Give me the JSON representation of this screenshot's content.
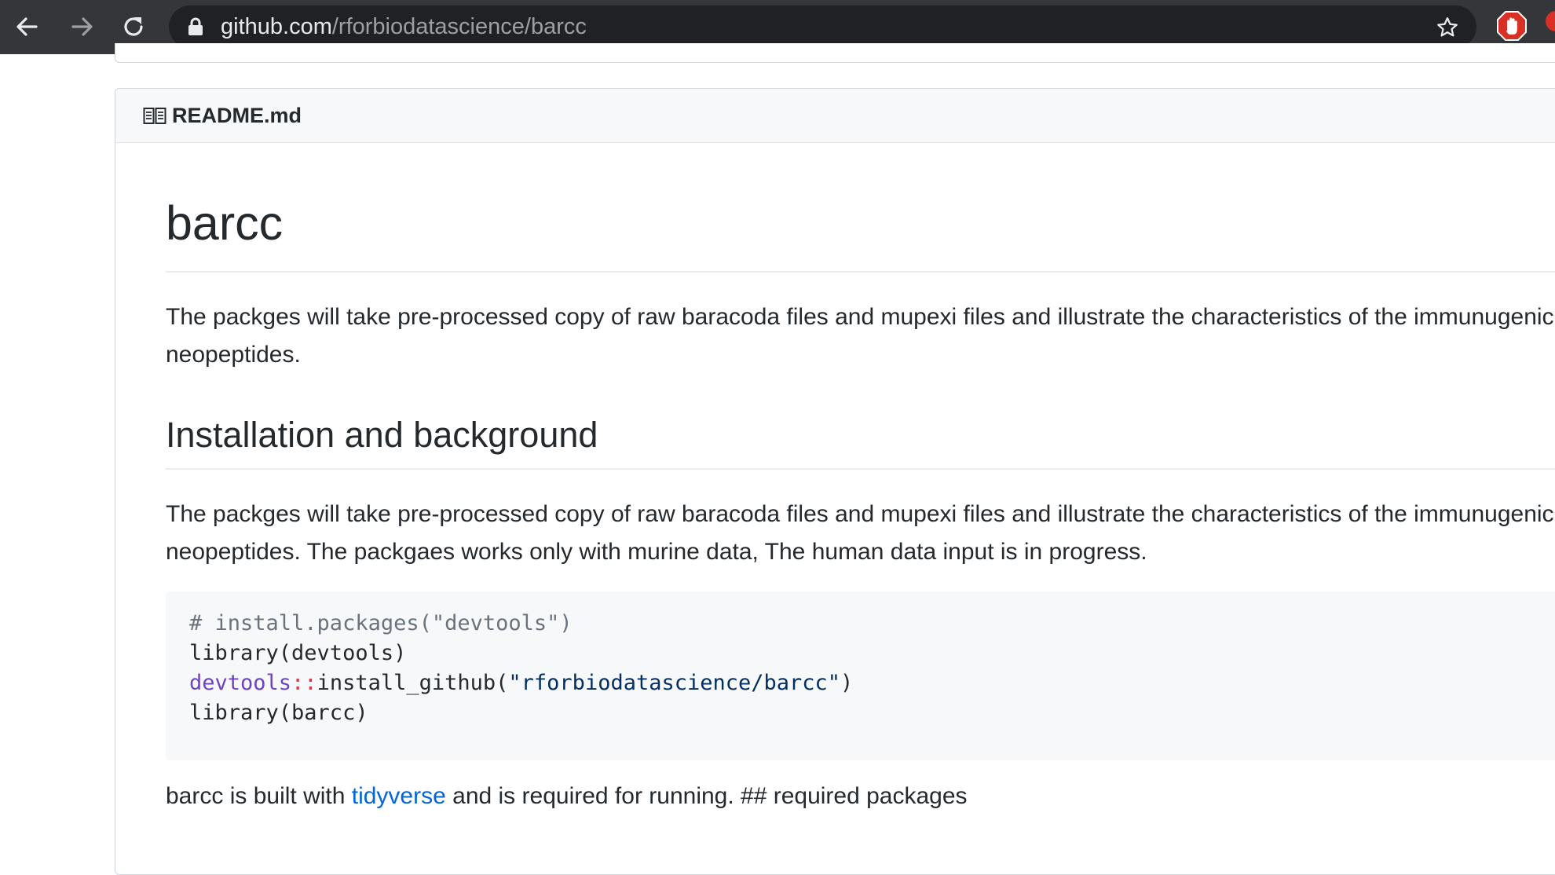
{
  "browser": {
    "url_host": "github.com",
    "url_path": "/rforbiodatascience/barcc",
    "icons": [
      "back-arrow-icon",
      "forward-arrow-icon",
      "reload-icon",
      "lock-icon",
      "star-icon",
      "adblock-hand-icon"
    ]
  },
  "readme": {
    "filename": "README.md",
    "title": "barcc",
    "intro": "The packges will take pre-processed copy of raw baracoda files and mupexi files and illustrate the characteristics of the immunugenic neopeptides.",
    "section_heading": "Installation and background",
    "section_para": "The packges will take pre-processed copy of raw baracoda files and mupexi files and illustrate the characteristics of the immunugenic neopeptides. The packgaes works only with murine data, The human data input is in progress.",
    "code": {
      "line1": "# install.packages(\"devtools\")",
      "line2": "library(devtools)",
      "line3_ns": "devtools",
      "line3_op": "::",
      "line3_fn": "install_github(",
      "line3_str": "\"rforbiodatascience/barcc\"",
      "line3_close": ")",
      "line4": "library(barcc)"
    },
    "footer_before": "barcc is built with ",
    "footer_link": "tidyverse",
    "footer_after": " and is required for running. ## required packages"
  },
  "colors": {
    "chrome_bg": "#35363a",
    "omnibox_bg": "#202124",
    "link": "#0366d6",
    "code_bg": "#f6f8fa",
    "abp_red": "#d93025"
  }
}
